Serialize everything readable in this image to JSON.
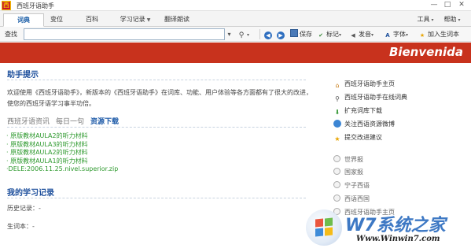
{
  "window": {
    "title": "西班牙语助手",
    "icon_label": "西",
    "minimize": "—",
    "maximize": "□",
    "close": "✕"
  },
  "tabs": [
    {
      "label": "词典",
      "active": true
    },
    {
      "label": "变位",
      "active": false
    },
    {
      "label": "百科",
      "active": false
    },
    {
      "label": "学习记录",
      "active": false,
      "dropdown": true
    },
    {
      "label": "翻译朗读",
      "active": false
    }
  ],
  "menu_right": {
    "tools": "工具",
    "help": "帮助"
  },
  "toolbar": {
    "label": "查找",
    "search_value": "",
    "save": "保存",
    "mark": "标记",
    "pronounce": "发音",
    "font": "字体",
    "add_vocab": "加入生词本"
  },
  "banner": {
    "text": "Bienvenida"
  },
  "tips": {
    "title": "助手提示",
    "line1": "欢迎使用《西班牙语助手》，新版本的《西班牙语助手》在词库、功能、用户体验等各方面都有了很大的改进，",
    "line2": "使您的西班牙语学习事半功倍。"
  },
  "subtabs": [
    {
      "label": "西班牙语资讯",
      "active": false
    },
    {
      "label": "每日一句",
      "active": false
    },
    {
      "label": "资源下载",
      "active": true
    }
  ],
  "downloads": [
    "· 原版教材AULA2的听力材料",
    "· 原版教材AULA3的听力材料",
    "· 原版教材AULA2的听力材料",
    "· 原版教材AULA1的听力材料",
    "·DELE:2006.11.25.nivel.superior.zip"
  ],
  "my_records": {
    "title": "我的学习记录",
    "history": "历史记录：-",
    "vocab": "生词本：-"
  },
  "sidebar": {
    "links": [
      {
        "label": "西班牙语助手主页",
        "icon": "home-icon"
      },
      {
        "label": "西班牙语助手在线词典",
        "icon": "search-icon"
      },
      {
        "label": "扩充词库下载",
        "icon": "download-icon"
      },
      {
        "label": "关注西语资源微博",
        "icon": "globe-icon"
      },
      {
        "label": "提交改进建议",
        "icon": "star-icon"
      }
    ],
    "radios": [
      {
        "label": "世界报"
      },
      {
        "label": "国家报"
      },
      {
        "label": "宁子西语"
      },
      {
        "label": "西语西国"
      },
      {
        "label": "西班牙语助手主页"
      }
    ]
  },
  "watermark": {
    "brand": "W7系统之家",
    "url": "Www.Winwin7.com"
  }
}
